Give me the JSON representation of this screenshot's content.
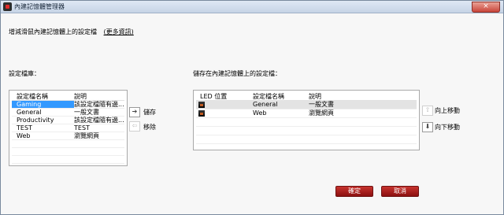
{
  "window": {
    "title": "內建記憶體管理器",
    "close_symbol": "×"
  },
  "intro": {
    "text": "增減滑鼠內建記憶體上的設定檔",
    "link": "(更多資訊)"
  },
  "library": {
    "label": "設定檔庫：",
    "columns": [
      "設定檔名稱",
      "說明"
    ],
    "rows": [
      {
        "name": "Gaming",
        "desc": "該設定檔隨有邊...",
        "selected": true
      },
      {
        "name": "General",
        "desc": "一般文書",
        "selected": false
      },
      {
        "name": "Productivity",
        "desc": "該設定檔隨有邊...",
        "selected": false
      },
      {
        "name": "TEST",
        "desc": "TEST",
        "selected": false
      },
      {
        "name": "Web",
        "desc": "瀏覽網頁",
        "selected": false
      }
    ]
  },
  "transfer": {
    "save_label": "儲存",
    "save_icon": "arrow-right",
    "remove_label": "移除",
    "remove_icon": "arrow-left"
  },
  "onboard": {
    "label": "儲存在內建記憶體上的設定檔：",
    "columns": [
      "LED 位置",
      "設定檔名稱",
      "說明"
    ],
    "rows": [
      {
        "name": "General",
        "desc": "一般文書",
        "selected": true
      },
      {
        "name": "Web",
        "desc": "瀏覽網頁",
        "selected": false
      }
    ]
  },
  "order": {
    "up_label": "向上移動",
    "up_icon": "arrow-up",
    "down_label": "向下移動",
    "down_icon": "arrow-down"
  },
  "footer": {
    "ok_label": "確定",
    "cancel_label": "取消"
  },
  "colors": {
    "selection": "#3399ff",
    "button": "#b52420",
    "title_bar": "#c6d4e6"
  }
}
